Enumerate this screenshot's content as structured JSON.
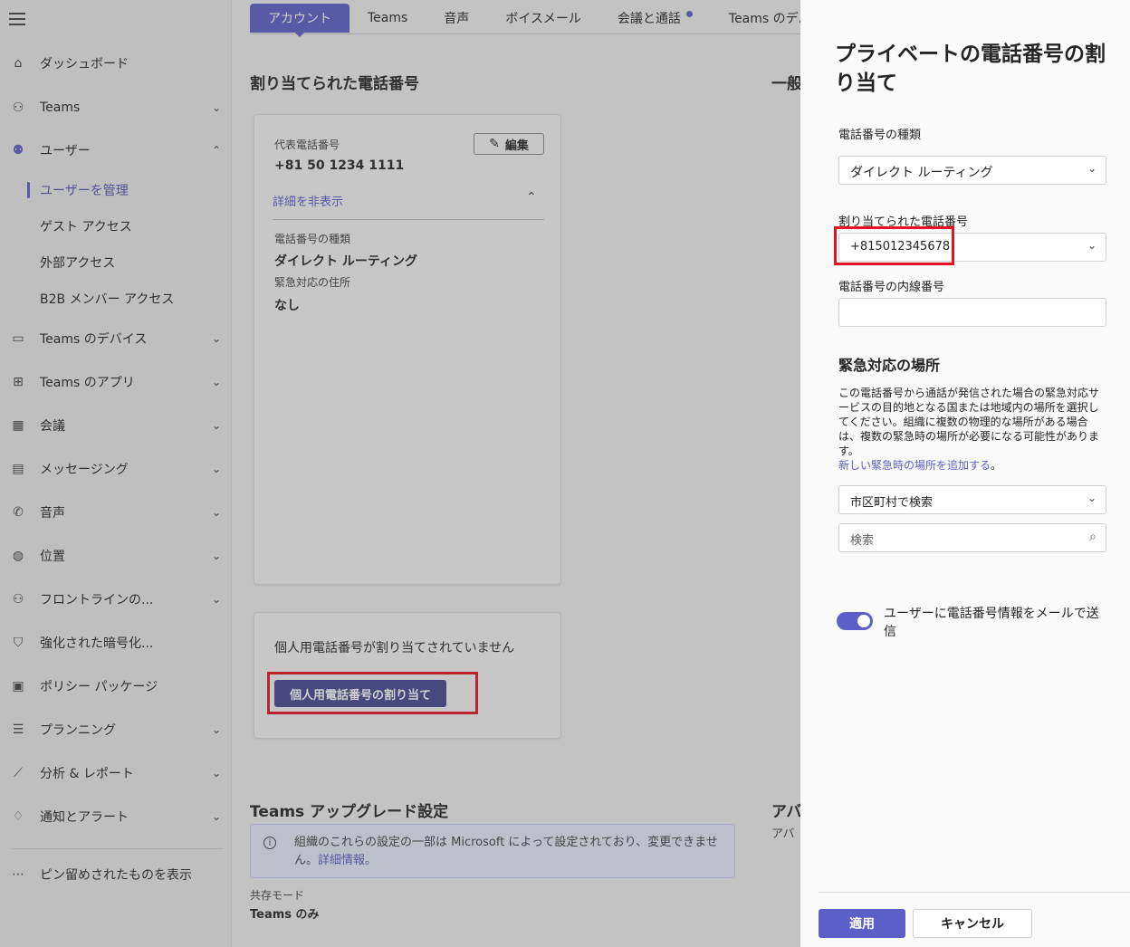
{
  "nav": {
    "items": [
      {
        "label": "ダッシュボード",
        "icon": "home-icon"
      },
      {
        "label": "Teams",
        "icon": "teams-icon"
      },
      {
        "label": "ユーザー",
        "icon": "users-icon"
      },
      {
        "label": "ユーザーを管理"
      },
      {
        "label": "ゲスト アクセス"
      },
      {
        "label": "外部アクセス"
      },
      {
        "label": "B2B メンバー アクセス"
      },
      {
        "label": "Teams のデバイス",
        "icon": "devices-icon"
      },
      {
        "label": "Teams のアプリ",
        "icon": "apps-icon"
      },
      {
        "label": "会議",
        "icon": "calendar-icon"
      },
      {
        "label": "メッセージング",
        "icon": "chat-icon"
      },
      {
        "label": "音声",
        "icon": "phone-icon"
      },
      {
        "label": "位置",
        "icon": "globe-icon"
      },
      {
        "label": "フロントラインの...",
        "icon": "frontline-icon"
      },
      {
        "label": "強化された暗号化...",
        "icon": "shield-icon"
      },
      {
        "label": "ポリシー パッケージ",
        "icon": "package-icon"
      },
      {
        "label": "プランニング",
        "icon": "planning-icon"
      },
      {
        "label": "分析 & レポート",
        "icon": "chart-icon"
      },
      {
        "label": "通知とアラート",
        "icon": "bell-icon"
      },
      {
        "label": "ピン留めされたものを表示",
        "icon": "more-icon"
      }
    ]
  },
  "tabs": [
    "アカウント",
    "Teams",
    "音声",
    "ボイスメール",
    "会議と通話",
    "Teams のデバ"
  ],
  "main": {
    "assigned_title": "割り当てられた電話番号",
    "general_title_partial": "一般",
    "primary_label": "代表電話番号",
    "primary_value": "+81 50 1234 1111",
    "edit_label": "編集",
    "hide_details": "詳細を非表示",
    "number_type_label": "電話番号の種類",
    "number_type_value": "ダイレクト ルーティング",
    "emergency_label": "緊急対応の住所",
    "emergency_value": "なし",
    "no_personal": "個人用電話番号が割り当てされていません",
    "assign_personal_btn": "個人用電話番号の割り当て",
    "upgrade_title": "Teams アップグレード設定",
    "app_title_partial": "アバ",
    "app_sub_partial": "アバ",
    "info_text": "組織のこれらの設定の一部は Microsoft によって設定されており、変更できません。",
    "info_link": "詳細情報。",
    "coexist_label": "共存モード",
    "coexist_value": "Teams のみ"
  },
  "panel": {
    "title": "プライベートの電話番号の割り当て",
    "number_type_label": "電話番号の種類",
    "number_type_value": "ダイレクト ルーティング",
    "assigned_label": "割り当てられた電話番号",
    "assigned_value": "+815012345678",
    "extension_label": "電話番号の内線番号",
    "extension_value": "",
    "emergency_title": "緊急対応の場所",
    "emergency_desc": "この電話番号から通話が発信された場合の緊急対応サービスの目的地となる国または地域内の場所を選択してください。組織に複数の物理的な場所がある場合は、複数の緊急時の場所が必要になる可能性があります。",
    "emergency_link": "新しい緊急時の場所を追加する",
    "emergency_link_suffix": "。",
    "city_search_value": "市区町村で検索",
    "search_placeholder": "検索",
    "toggle_label": "ユーザーに電話番号情報をメールで送信",
    "toggle_on": true,
    "apply_label": "適用",
    "cancel_label": "キャンセル"
  },
  "colors": {
    "accent": "#5b5fc7",
    "highlight": "#e81123"
  }
}
